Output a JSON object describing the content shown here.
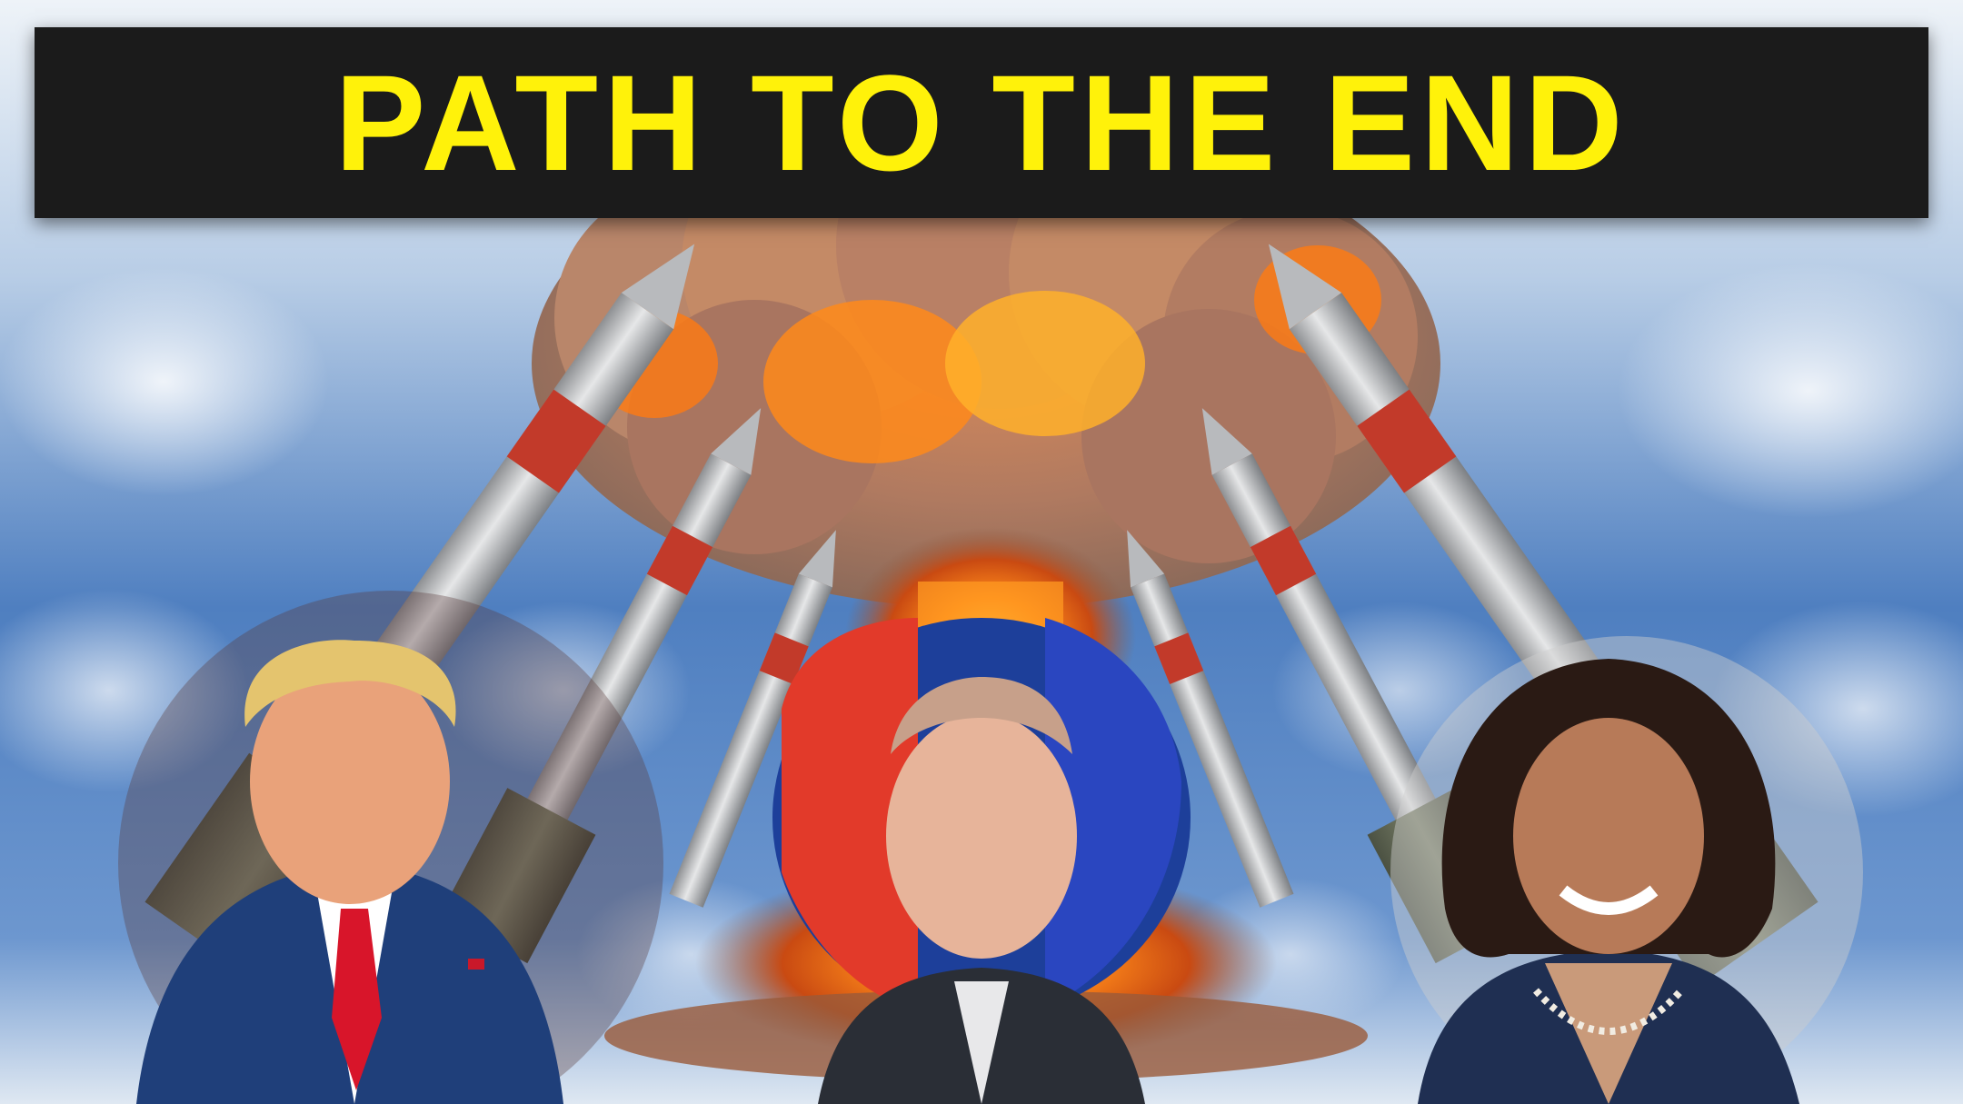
{
  "headline": "PATH TO THE END",
  "colors": {
    "headline_text": "#fff20a",
    "headline_bar": "#1b1b1b",
    "sky": "#4f7fc0",
    "fire": "#ff7a00"
  },
  "subjects": [
    {
      "role": "left-portrait",
      "description_icon": "man-in-suit-red-tie"
    },
    {
      "role": "center-portrait",
      "description_icon": "man-with-flag-background"
    },
    {
      "role": "right-portrait",
      "description_icon": "woman-smiling-pearl-necklace"
    }
  ]
}
